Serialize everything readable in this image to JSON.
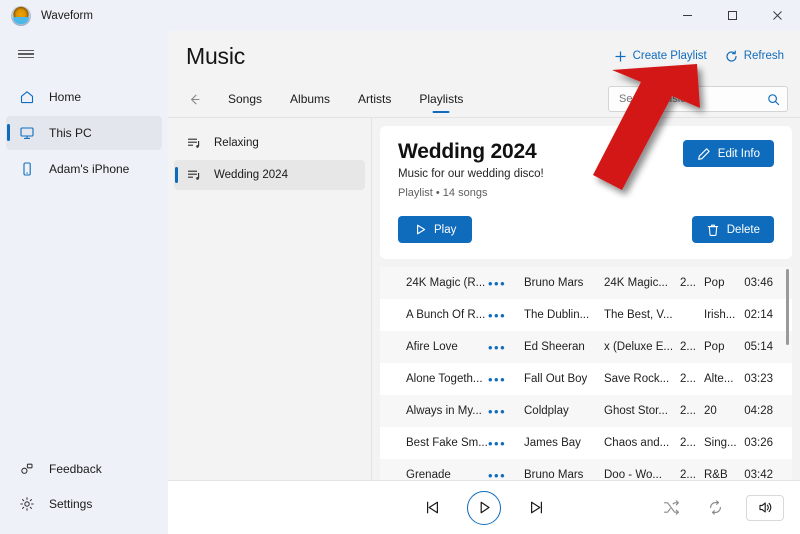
{
  "window": {
    "app_title": "Waveform",
    "logo_icon": "waveform-logo-icon",
    "minimize_label": "Minimize",
    "maximize_label": "Maximize",
    "close_label": "Close"
  },
  "colors": {
    "accent": "#0f6cbd",
    "nav_background": "#eef1f7",
    "page_background": "#f3f3f3",
    "card_background": "#ffffff",
    "annotation_arrow": "#d31616"
  },
  "nav": {
    "menu_icon": "hamburger-menu-icon",
    "items": [
      {
        "label": "Home",
        "icon": "home-icon",
        "selected": false
      },
      {
        "label": "This PC",
        "icon": "monitor-icon",
        "selected": true
      },
      {
        "label": "Adam's iPhone",
        "icon": "phone-icon",
        "selected": false
      }
    ],
    "bottom_items": [
      {
        "label": "Feedback",
        "icon": "feedback-icon"
      },
      {
        "label": "Settings",
        "icon": "gear-icon"
      }
    ]
  },
  "header": {
    "title": "Music",
    "create_playlist_label": "Create Playlist",
    "create_playlist_icon": "plus-icon",
    "refresh_label": "Refresh",
    "refresh_icon": "refresh-icon"
  },
  "tabs": {
    "back_icon": "back-arrow-icon",
    "items": [
      {
        "label": "Songs",
        "active": false
      },
      {
        "label": "Albums",
        "active": false
      },
      {
        "label": "Artists",
        "active": false
      },
      {
        "label": "Playlists",
        "active": true
      }
    ],
    "search": {
      "placeholder": "Search music",
      "value": "",
      "icon": "search-icon"
    }
  },
  "playlist_pane": {
    "items": [
      {
        "label": "Relaxing",
        "icon": "playlist-icon",
        "selected": false
      },
      {
        "label": "Wedding 2024",
        "icon": "playlist-icon",
        "selected": true
      }
    ]
  },
  "playlist_detail": {
    "title": "Wedding 2024",
    "description": "Music for our wedding disco!",
    "meta": "Playlist • 14 songs",
    "play_label": "Play",
    "play_icon": "play-icon",
    "edit_label": "Edit Info",
    "edit_icon": "pencil-icon",
    "delete_label": "Delete",
    "delete_icon": "trash-icon"
  },
  "tracks": {
    "more_glyph": "•••",
    "rows": [
      {
        "title": "24K Magic (R...",
        "artist": "Bruno Mars",
        "album": "24K Magic...",
        "year": "2...",
        "genre": "Pop",
        "duration": "03:46"
      },
      {
        "title": "A Bunch Of R...",
        "artist": "The Dublin...",
        "album": "The Best, V...",
        "year": "",
        "genre": "Irish...",
        "duration": "02:14"
      },
      {
        "title": "Afire Love",
        "artist": "Ed Sheeran",
        "album": "x (Deluxe E...",
        "year": "2...",
        "genre": "Pop",
        "duration": "05:14"
      },
      {
        "title": "Alone Togeth...",
        "artist": "Fall Out Boy",
        "album": "Save Rock...",
        "year": "2...",
        "genre": "Alte...",
        "duration": "03:23"
      },
      {
        "title": "Always in My...",
        "artist": "Coldplay",
        "album": "Ghost Stor...",
        "year": "2...",
        "genre": "20",
        "duration": "04:28"
      },
      {
        "title": "Best Fake Sm...",
        "artist": "James Bay",
        "album": "Chaos and...",
        "year": "2...",
        "genre": "Sing...",
        "duration": "03:26"
      },
      {
        "title": "Grenade",
        "artist": "Bruno Mars",
        "album": "Doo - Wo...",
        "year": "2...",
        "genre": "R&B",
        "duration": "03:42"
      }
    ]
  },
  "player": {
    "previous_icon": "previous-track-icon",
    "play_icon": "play-icon",
    "next_icon": "next-track-icon",
    "shuffle_icon": "shuffle-icon",
    "repeat_icon": "repeat-icon",
    "volume_icon": "volume-icon"
  },
  "annotation": {
    "arrow_icon": "red-arrow-up-right-icon",
    "points_at": "Create Playlist"
  }
}
